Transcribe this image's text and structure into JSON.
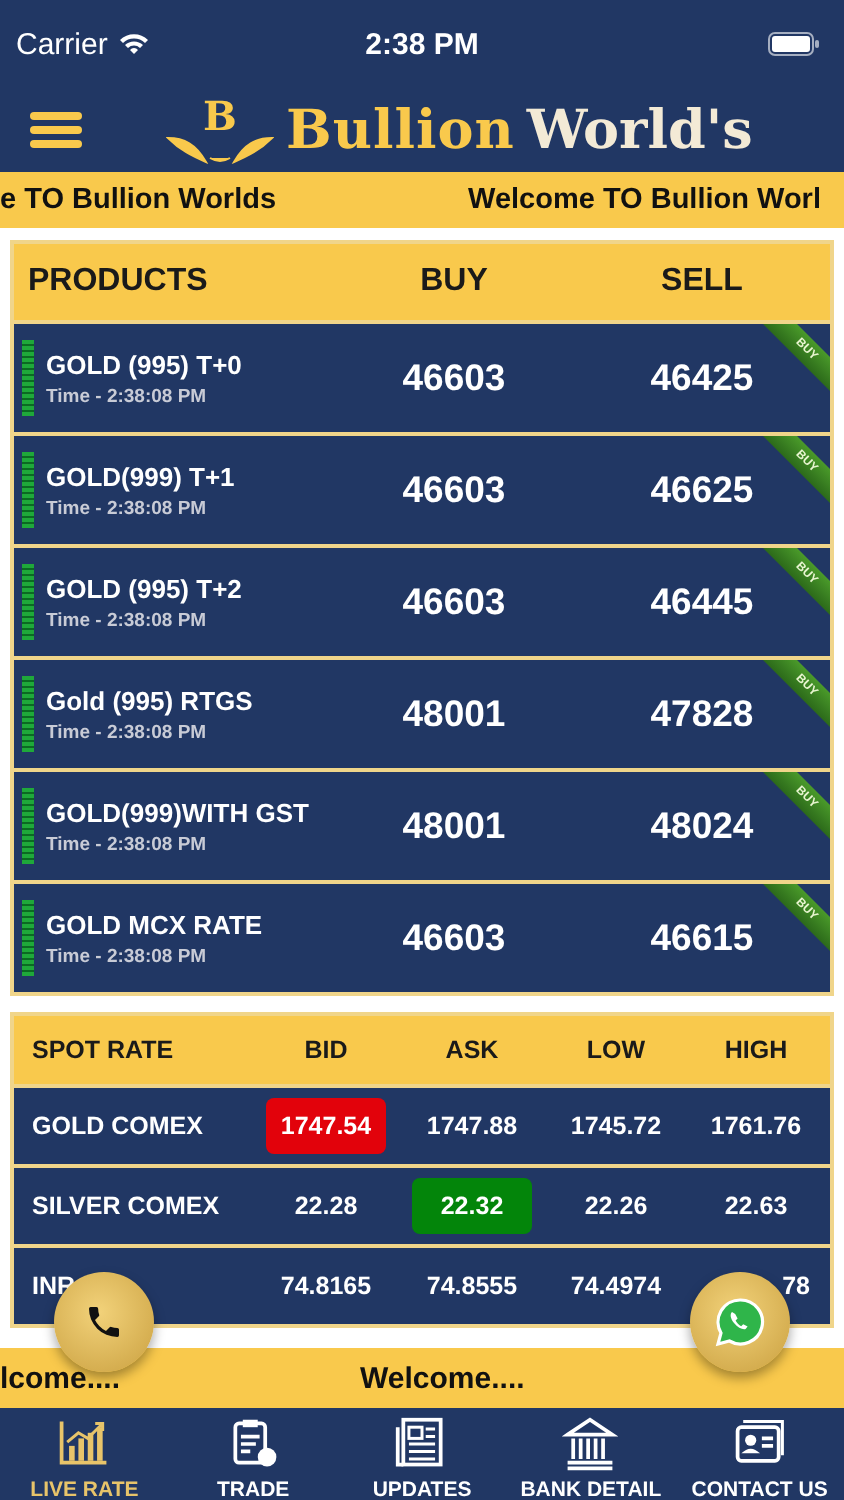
{
  "status_bar": {
    "carrier": "Carrier",
    "time": "2:38 PM"
  },
  "header": {
    "logo": {
      "initial": "B",
      "name_1": "Bullion",
      "name_2": "World's"
    }
  },
  "top_ticker": [
    "e TO Bullion Worlds",
    "Welcome TO Bullion Worl"
  ],
  "products": {
    "columns": [
      "PRODUCTS",
      "BUY",
      "SELL"
    ],
    "rows": [
      {
        "name": "GOLD (995) T+0",
        "time": "Time - 2:38:08 PM",
        "buy": "46603",
        "sell": "46425",
        "ribbon": "BUY"
      },
      {
        "name": "GOLD(999) T+1",
        "time": "Time - 2:38:08 PM",
        "buy": "46603",
        "sell": "46625",
        "ribbon": "BUY"
      },
      {
        "name": "GOLD (995) T+2",
        "time": "Time - 2:38:08 PM",
        "buy": "46603",
        "sell": "46445",
        "ribbon": "BUY"
      },
      {
        "name": "Gold (995) RTGS",
        "time": "Time - 2:38:08 PM",
        "buy": "48001",
        "sell": "47828",
        "ribbon": "BUY"
      },
      {
        "name": "GOLD(999)WITH GST",
        "time": "Time - 2:38:08 PM",
        "buy": "48001",
        "sell": "48024",
        "ribbon": "BUY"
      },
      {
        "name": "GOLD MCX RATE",
        "time": "Time - 2:38:08 PM",
        "buy": "46603",
        "sell": "46615",
        "ribbon": "BUY"
      }
    ]
  },
  "spot_rates": {
    "columns": [
      "SPOT RATE",
      "BID",
      "ASK",
      "LOW",
      "HIGH"
    ],
    "rows": [
      {
        "cells": [
          {
            "text": "GOLD COMEX",
            "kind": "label"
          },
          {
            "text": "1747.54",
            "kind": "down"
          },
          {
            "text": "1747.88",
            "kind": "plain"
          },
          {
            "text": "1745.72",
            "kind": "plain"
          },
          {
            "text": "1761.76",
            "kind": "plain"
          }
        ]
      },
      {
        "cells": [
          {
            "text": "SILVER COMEX",
            "kind": "label"
          },
          {
            "text": "22.28",
            "kind": "plain"
          },
          {
            "text": "22.32",
            "kind": "up"
          },
          {
            "text": "22.26",
            "kind": "plain"
          },
          {
            "text": "22.63",
            "kind": "plain"
          }
        ]
      },
      {
        "cells": [
          {
            "text": "INR",
            "kind": "label"
          },
          {
            "text": "74.8165",
            "kind": "plain"
          },
          {
            "text": "74.8555",
            "kind": "plain"
          },
          {
            "text": "74.4974",
            "kind": "plain"
          },
          {
            "text": "78",
            "kind": "tail"
          }
        ]
      }
    ]
  },
  "bottom_ticker": [
    "lcome....",
    "Welcome...."
  ],
  "tabs": [
    {
      "label": "LIVE RATE",
      "kind": "chart",
      "selected": true
    },
    {
      "label": "TRADE",
      "kind": "clipboard",
      "selected": false
    },
    {
      "label": "UPDATES",
      "kind": "newspaper",
      "selected": false
    },
    {
      "label": "BANK DETAIL",
      "kind": "bank",
      "selected": false
    },
    {
      "label": "CONTACT US",
      "kind": "card",
      "selected": false
    }
  ]
}
